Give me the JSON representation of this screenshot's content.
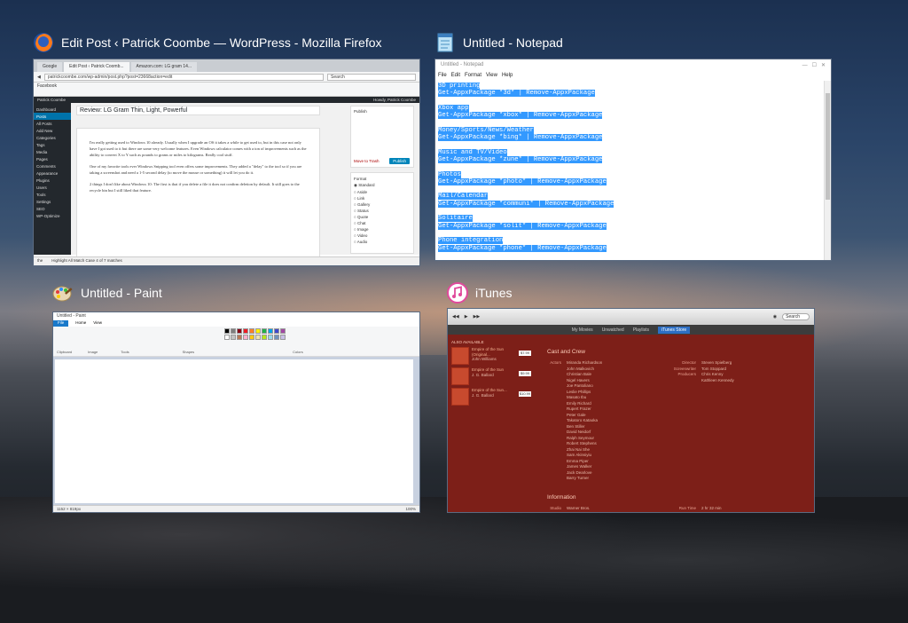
{
  "windows": {
    "firefox": {
      "title": "Edit Post ‹ Patrick Coombe — WordPress - Mozilla Firefox",
      "icon": "firefox-icon",
      "tabs": [
        "Google",
        "Edit Post ‹ Patrick Coomb...",
        "Amazon.com: LG gram 14..."
      ],
      "url": "patrickcoombe.com/wp-admin/post.php?post=23668action=edit",
      "search_placeholder": "Search",
      "bookmarks": "Facebook",
      "wp_bar_left": "Patrick Coombe",
      "wp_bar_right": "Howdy, Patrick Coombe",
      "sidebar": [
        "Dashboard",
        "Posts",
        "All Posts",
        "Add New",
        "Categories",
        "Tags",
        "Media",
        "Pages",
        "Comments",
        "Appearance",
        "Plugins",
        "Users",
        "Tools",
        "Settings",
        "SEO",
        "WP-Optimize"
      ],
      "post_title": "Review: LG Gram Thin, Light, Powerful",
      "paragraphs": [
        "I'm really getting used to Windows 10 already. Usually when I upgrade an OS it takes a while to get used to, but in this case not only have I got used to it but there are some very welcome features. Even Windows calculator comes with a ton of improvements such as the ability to convert X to Y such as pounds to grams or miles to kilograms. Really cool stuff.",
        "One of my favorite tools ever Windows Snipping tool even offers some improvements. They added a \"delay\" to the tool so if you are taking a screenshot and need a 1-5 second delay (to move the mouse or something) it will let you do it.",
        "2 things I don't like about Windows 10: The first is that if you delete a file it does not confirm deletion by default. It still goes to the recycle bin but I still liked that feature."
      ],
      "publish_label": "Publish",
      "publish_button": "Publish",
      "move_to_trash": "Move to Trash",
      "format_label": "Format",
      "formats": [
        "Standard",
        "Aside",
        "Link",
        "Gallery",
        "Status",
        "Quote",
        "Chat",
        "Image",
        "Video",
        "Audio"
      ],
      "find_bar": "Highlight All    Match Case    4 of 7 matches",
      "find_value": "the"
    },
    "notepad": {
      "title": "Untitled - Notepad",
      "icon": "notepad-icon",
      "inner_title": "Untitled - Notepad",
      "menu": [
        "File",
        "Edit",
        "Format",
        "View",
        "Help"
      ],
      "lines": [
        "3D printing",
        "Get-AppxPackage *3d* | Remove-AppxPackage",
        "",
        "Xbox app",
        "Get-AppxPackage *xbox* | Remove-AppxPackage",
        "",
        "Money/Sports/News/Weather",
        "Get-AppxPackage *bing* | Remove-AppxPackage",
        "",
        "Music and TV/Video",
        "Get-AppxPackage *zune* | Remove-AppxPackage",
        "",
        "Photos",
        "Get-AppxPackage *photo* | Remove-AppxPackage",
        "",
        "Mail/Calendar",
        "Get-AppxPackage *communi* | Remove-AppxPackage",
        "",
        "Solitaire",
        "Get-AppxPackage *solit* | Remove-AppxPackage",
        "",
        "Phone integration",
        "Get-AppxPackage *phone* | Remove-AppxPackage"
      ]
    },
    "paint": {
      "title": "Untitled - Paint",
      "icon": "paint-icon",
      "inner_title": "Untitled - Paint",
      "ribbon_tabs": [
        "File",
        "Home",
        "View"
      ],
      "ribbon_groups": [
        "Clipboard",
        "Image",
        "Tools",
        "Shapes",
        "Colors"
      ],
      "status_size": "1152 × 819px",
      "zoom": "100%"
    },
    "itunes": {
      "title": "iTunes",
      "icon": "itunes-icon",
      "search_placeholder": "Search",
      "nav": [
        "My Movies",
        "Unwatched",
        "Playlists",
        "iTunes Store"
      ],
      "also_available": "ALSO AVAILABLE",
      "albums": [
        {
          "name": "Empire of the Sun (Original...",
          "artist": "John Williams",
          "price": "$7.99"
        },
        {
          "name": "Empire of the Sun",
          "artist": "J. G. Ballard",
          "price": "$9.99"
        },
        {
          "name": "Empire of the Sun...",
          "artist": "J. G. Ballard",
          "price": "$10.99"
        }
      ],
      "cast_heading": "Cast and Crew",
      "actors_label": "Actors",
      "actors": [
        "Miranda Richardson",
        "John Malkovich",
        "Christian Bale",
        "Nigel Havers",
        "Joe Pantoliano",
        "Leslie Phillips",
        "Masato Ibu",
        "Emily Richard",
        "Rupert Frazer",
        "Peter Gale",
        "Takatoro Kataoka",
        "Ben Stiller",
        "David Neidorf",
        "Ralph Seymour",
        "Robert Stephens",
        "Zhai Nai She",
        "Sam Akinsiyiu",
        "Emma Piper",
        "James Walker",
        "Jack Dearlove",
        "Barry Turner"
      ],
      "director_label": "Director",
      "director": "Steven Spielberg",
      "screenwriter_label": "Screenwriter",
      "screenwriter": "Tom Stoppard",
      "producers_label": "Producers",
      "producers": [
        "Chris Kenny",
        "Kathleen Kennedy"
      ],
      "info_heading": "Information",
      "studio_label": "Studio",
      "studio": "Warner Bros.",
      "runtime_label": "Run Time",
      "runtime": "2 hr 32 min"
    }
  }
}
